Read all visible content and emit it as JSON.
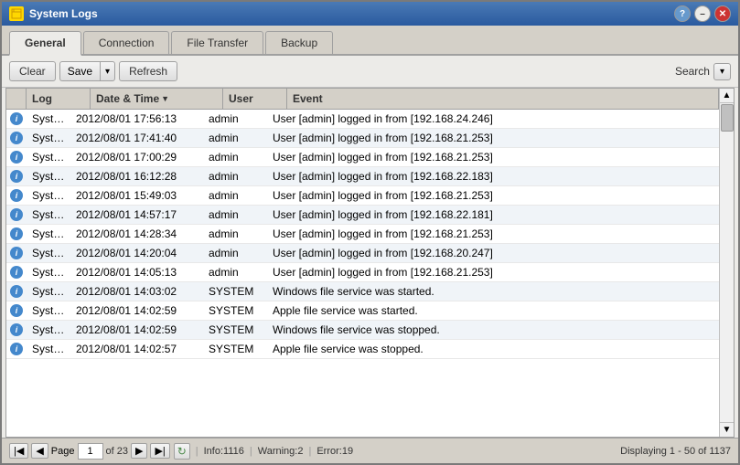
{
  "window": {
    "title": "System Logs",
    "icon": "📋"
  },
  "title_buttons": {
    "help": "?",
    "minimize": "–",
    "close": "✕"
  },
  "tabs": [
    {
      "id": "general",
      "label": "General",
      "active": true
    },
    {
      "id": "connection",
      "label": "Connection",
      "active": false
    },
    {
      "id": "file-transfer",
      "label": "File Transfer",
      "active": false
    },
    {
      "id": "backup",
      "label": "Backup",
      "active": false
    }
  ],
  "toolbar": {
    "clear_label": "Clear",
    "save_label": "Save",
    "refresh_label": "Refresh",
    "search_label": "Search"
  },
  "table": {
    "columns": [
      "Log",
      "Date & Time",
      "User",
      "Event"
    ],
    "rows": [
      {
        "icon": "i",
        "log": "System",
        "date": "2012/08/01 17:56:13",
        "user": "admin",
        "event": "User [admin] logged in from [192.168.24.246]"
      },
      {
        "icon": "i",
        "log": "System",
        "date": "2012/08/01 17:41:40",
        "user": "admin",
        "event": "User [admin] logged in from [192.168.21.253]"
      },
      {
        "icon": "i",
        "log": "System",
        "date": "2012/08/01 17:00:29",
        "user": "admin",
        "event": "User [admin] logged in from [192.168.21.253]"
      },
      {
        "icon": "i",
        "log": "System",
        "date": "2012/08/01 16:12:28",
        "user": "admin",
        "event": "User [admin] logged in from [192.168.22.183]"
      },
      {
        "icon": "i",
        "log": "System",
        "date": "2012/08/01 15:49:03",
        "user": "admin",
        "event": "User [admin] logged in from [192.168.21.253]"
      },
      {
        "icon": "i",
        "log": "System",
        "date": "2012/08/01 14:57:17",
        "user": "admin",
        "event": "User [admin] logged in from [192.168.22.181]"
      },
      {
        "icon": "i",
        "log": "System",
        "date": "2012/08/01 14:28:34",
        "user": "admin",
        "event": "User [admin] logged in from [192.168.21.253]"
      },
      {
        "icon": "i",
        "log": "System",
        "date": "2012/08/01 14:20:04",
        "user": "admin",
        "event": "User [admin] logged in from [192.168.20.247]"
      },
      {
        "icon": "i",
        "log": "System",
        "date": "2012/08/01 14:05:13",
        "user": "admin",
        "event": "User [admin] logged in from [192.168.21.253]"
      },
      {
        "icon": "i",
        "log": "System",
        "date": "2012/08/01 14:03:02",
        "user": "SYSTEM",
        "event": "Windows file service was started."
      },
      {
        "icon": "i",
        "log": "System",
        "date": "2012/08/01 14:02:59",
        "user": "SYSTEM",
        "event": "Apple file service was started."
      },
      {
        "icon": "i",
        "log": "System",
        "date": "2012/08/01 14:02:59",
        "user": "SYSTEM",
        "event": "Windows file service was stopped."
      },
      {
        "icon": "i",
        "log": "System",
        "date": "2012/08/01 14:02:57",
        "user": "SYSTEM",
        "event": "Apple file service was stopped."
      }
    ]
  },
  "status_bar": {
    "page_label": "Page",
    "page_current": "1",
    "page_total": "of 23",
    "info_count": "Info:1116",
    "warning_count": "Warning:2",
    "error_count": "Error:19",
    "displaying": "Displaying 1 - 50 of 1137"
  }
}
